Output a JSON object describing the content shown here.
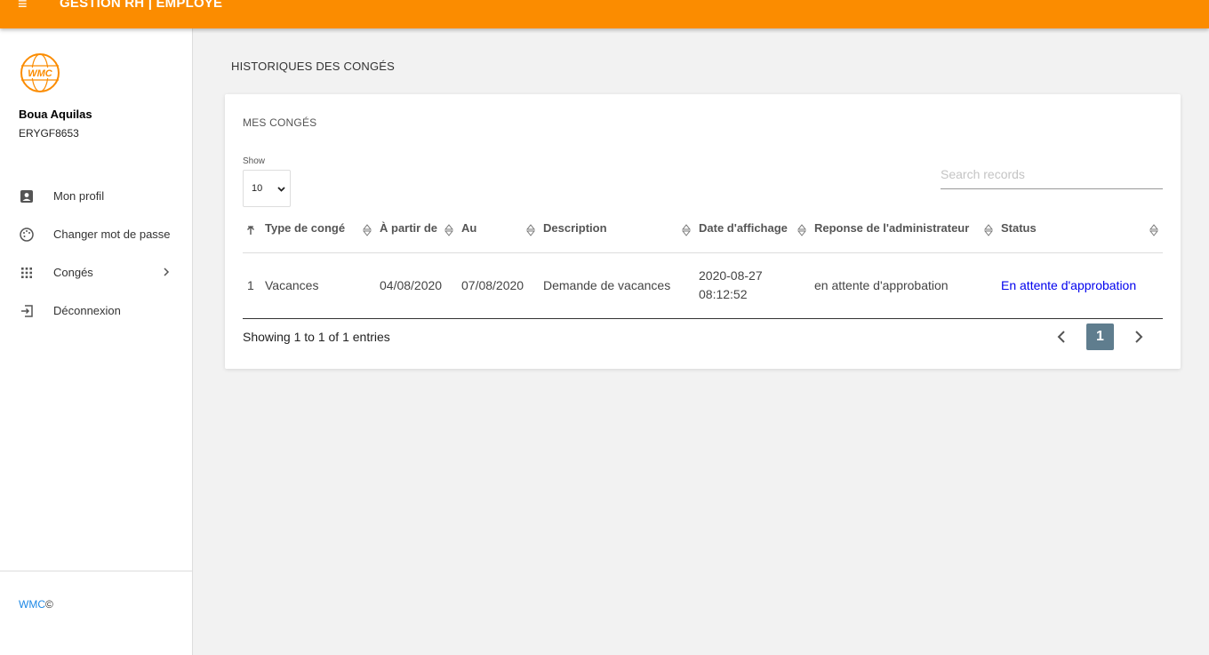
{
  "header": {
    "menu_glyph": "≡",
    "title": "GESTION RH | EMPLOYE"
  },
  "user": {
    "name": "Boua Aquilas",
    "id": "ERYGF8653",
    "logo_text": "WMC"
  },
  "sidebar": {
    "items": [
      {
        "label": "Mon profil",
        "icon": "account-box-icon"
      },
      {
        "label": "Changer mot de passe",
        "icon": "palette-icon"
      },
      {
        "label": "Congés",
        "icon": "apps-grid-icon"
      },
      {
        "label": "Déconnexion",
        "icon": "logout-icon"
      }
    ],
    "footer_brand": "WMC",
    "footer_symbol": "©"
  },
  "page": {
    "title": "HISTORIQUES DES CONGÉS"
  },
  "card": {
    "title": "MES CONGÉS",
    "show_label": "Show",
    "show_value": "10",
    "search_placeholder": "Search records",
    "columns": [
      "Type de congé",
      "À partir de",
      "Au",
      "Description",
      "Date d'affichage",
      "Reponse de l'administrateur",
      "Status"
    ],
    "rows": [
      {
        "index": "1",
        "type": "Vacances",
        "from": "04/08/2020",
        "to": "07/08/2020",
        "description": "Demande de vacances",
        "date_line1": "2020-08-27",
        "date_line2": "08:12:52",
        "response": "en attente d'approbation",
        "status": "En attente d'approbation"
      }
    ],
    "showing": "Showing 1 to 1 of 1 entries",
    "current_page": "1"
  },
  "colors": {
    "accent": "#fb8c00",
    "link": "#0000ee",
    "pagination": "#5f7d8e",
    "brand_link": "#1e88e5"
  }
}
